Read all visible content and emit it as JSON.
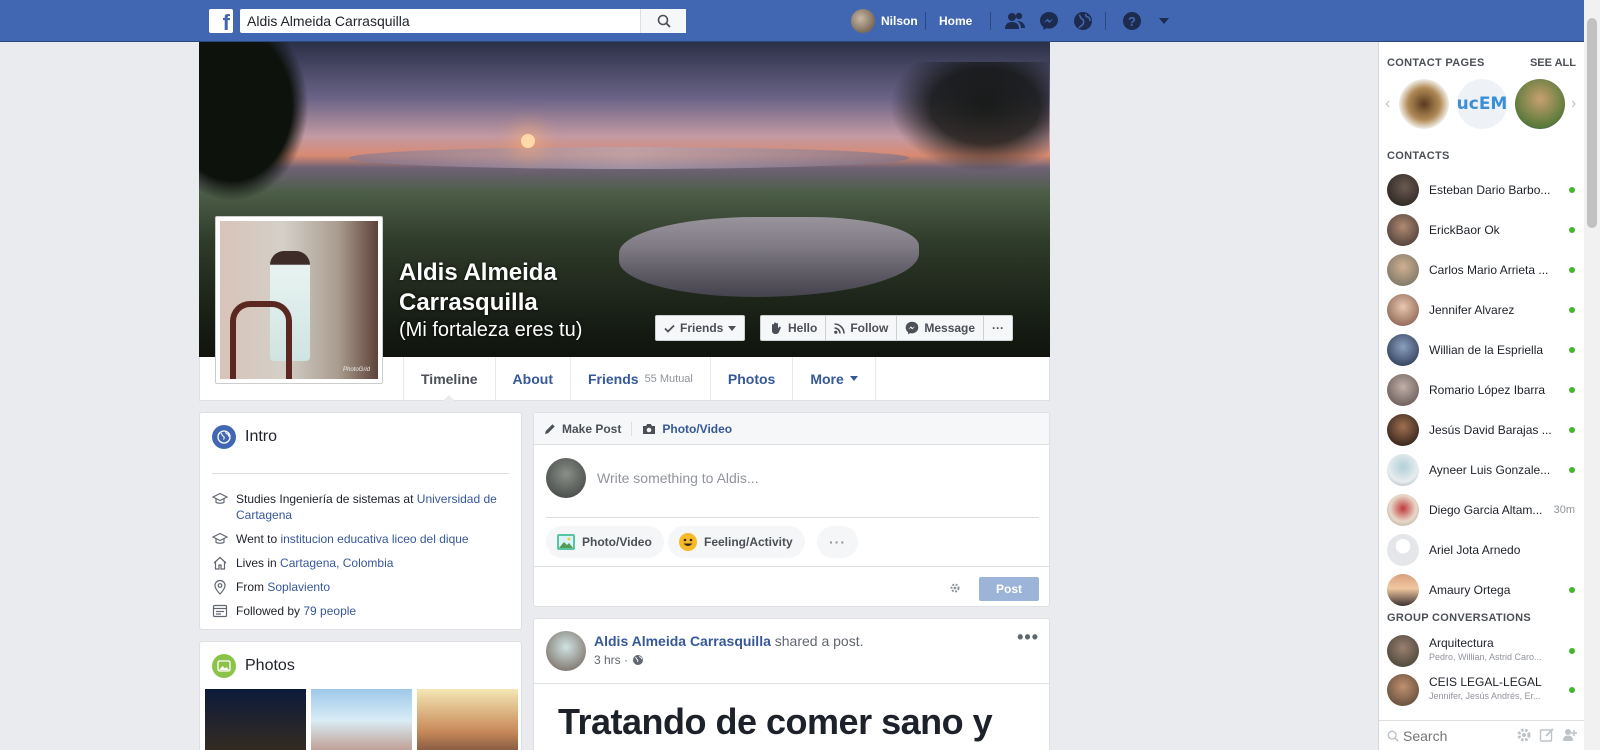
{
  "topbar": {
    "search_value": "Aldis Almeida Carrasquilla",
    "user_name": "Nilson",
    "home_label": "Home",
    "brand_color": "#4267b2"
  },
  "profile": {
    "name": "Aldis Almeida Carrasquilla",
    "nickname": "(Mi fortaleza eres tu)",
    "photo_watermark": "PhotoGrid",
    "buttons": {
      "friends": "Friends",
      "hello": "Hello",
      "follow": "Follow",
      "message": "Message",
      "more": "···"
    }
  },
  "tabs": [
    {
      "label": "Timeline"
    },
    {
      "label": "About"
    },
    {
      "label": "Friends",
      "sub": "55 Mutual"
    },
    {
      "label": "Photos"
    },
    {
      "label": "More"
    }
  ],
  "intro": {
    "title": "Intro",
    "items": [
      {
        "icon": "graduation-cap-icon",
        "prefix": "Studies Ingeniería de sistemas at ",
        "link": "Universidad de Cartagena"
      },
      {
        "icon": "graduation-cap-icon",
        "prefix": "Went to ",
        "link": "institucion educativa liceo del dique"
      },
      {
        "icon": "home-icon",
        "prefix": "Lives in ",
        "link": "Cartagena, Colombia"
      },
      {
        "icon": "location-pin-icon",
        "prefix": "From ",
        "link": "Soplaviento"
      },
      {
        "icon": "followers-icon",
        "prefix": "Followed by ",
        "link": "79 people"
      }
    ]
  },
  "photos_card": {
    "title": "Photos"
  },
  "composer": {
    "make_post": "Make Post",
    "photo_video_tab": "Photo/Video",
    "placeholder": "Write something to Aldis...",
    "photo_video": "Photo/Video",
    "feeling": "Feeling/Activity",
    "more": "···",
    "post": "Post"
  },
  "post": {
    "author": "Aldis Almeida Carrasquilla",
    "action": " shared a post.",
    "time": "3 hrs ·",
    "text": "Tratando de comer sano y"
  },
  "sidebar": {
    "contact_pages_title": "CONTACT PAGES",
    "see_all": "SEE ALL",
    "page_circles": [
      "",
      "ucEM",
      ""
    ],
    "contacts_title": "CONTACTS",
    "contacts": [
      {
        "name": "Esteban Dario Barbo...",
        "status": "online"
      },
      {
        "name": "ErickBaor Ok",
        "status": "online"
      },
      {
        "name": "Carlos Mario Arrieta ...",
        "status": "online"
      },
      {
        "name": "Jennifer Alvarez",
        "status": "online"
      },
      {
        "name": "Willian de la Espriella",
        "status": "online"
      },
      {
        "name": "Romario López Ibarra",
        "status": "online"
      },
      {
        "name": "Jesús David Barajas ...",
        "status": "online"
      },
      {
        "name": "Ayneer Luis Gonzale...",
        "status": "online"
      },
      {
        "name": "Diego Garcia Altam...",
        "status": "30m"
      },
      {
        "name": "Ariel Jota Arnedo",
        "status": ""
      },
      {
        "name": "Amaury Ortega",
        "status": "online"
      }
    ],
    "groups_title": "GROUP CONVERSATIONS",
    "groups": [
      {
        "name": "Arquitectura",
        "members": "Pedro, Willian, Astrid Caro..."
      },
      {
        "name": "CEIS LEGAL-LEGAL",
        "members": "Jennifer, Jesús Andrés, Er..."
      }
    ],
    "search_placeholder": "Search",
    "online_color": "#42b72a"
  }
}
